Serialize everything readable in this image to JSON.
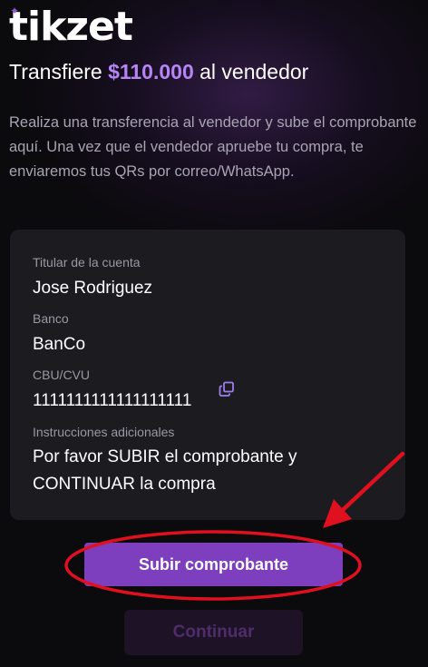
{
  "brand": {
    "name": "tikzet",
    "accent": "#b684f5"
  },
  "header": {
    "title_prefix": "Transfiere ",
    "amount": "$110.000",
    "title_suffix": " al vendedor",
    "description": "Realiza una transferencia al vendedor y sube el comprobante aquí. Una vez que el vendedor apruebe tu compra, te enviaremos tus QRs por correo/WhatsApp."
  },
  "account": {
    "holder_label": "Titular de la cuenta",
    "holder_value": "Jose Rodriguez",
    "bank_label": "Banco",
    "bank_value": "BanCo",
    "cbu_label": "CBU/CVU",
    "cbu_value": "1111111111111111111",
    "instructions_label": "Instrucciones adicionales",
    "instructions_value": "Por favor SUBIR el comprobante y CONTINUAR la compra",
    "copy_icon": "copy-icon"
  },
  "actions": {
    "upload_label": "Subir comprobante",
    "continue_label": "Continuar"
  },
  "annotation": {
    "color": "#e0101e"
  }
}
